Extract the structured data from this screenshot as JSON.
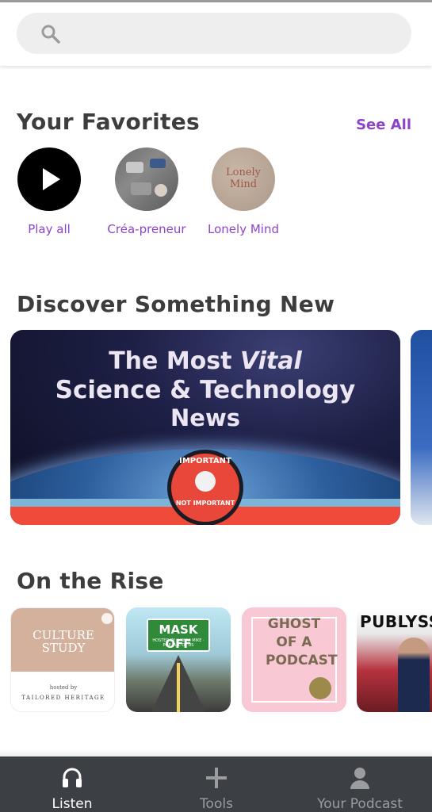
{
  "search": {
    "placeholder": ""
  },
  "favorites": {
    "title": "Your Favorites",
    "see_all": "See All",
    "items": [
      {
        "label": "Play all",
        "icon": "play-icon"
      },
      {
        "label": "Créa-preneur",
        "icon": "podcast-cover"
      },
      {
        "label": "Lonely Mind",
        "icon": "podcast-cover",
        "cover_text": "Lonely Mind"
      }
    ]
  },
  "discover": {
    "title": "Discover Something New",
    "banner": {
      "line1_prefix": "The Most ",
      "line1_emph": "Vital",
      "line2": "Science & Technology",
      "line3": "News",
      "badge_top": "IMPORTANT",
      "badge_bottom": "NOT IMPORTANT"
    }
  },
  "rise": {
    "title": "On the Rise",
    "items": [
      {
        "cover_title": "CULTURE STUDY",
        "hosted": "hosted by",
        "brand": "TAILORED HERITAGE"
      },
      {
        "cover_title": "MASK OFF",
        "cover_sub": "HOSTED BY HAWAII MIKE · POP, ALL OF US"
      },
      {
        "cover_title": "GHOST OF A PODCAST"
      },
      {
        "cover_title": "PUBLYSS"
      }
    ]
  },
  "tabs": [
    {
      "label": "Listen",
      "icon": "headphones-icon",
      "active": true
    },
    {
      "label": "Tools",
      "icon": "plus-icon",
      "active": false
    },
    {
      "label": "Your Podcast",
      "icon": "user-icon",
      "active": false
    }
  ],
  "colors": {
    "accent": "#8e44c9",
    "tabbar": "#3c3f44",
    "banner_red": "#ef4a3a"
  }
}
